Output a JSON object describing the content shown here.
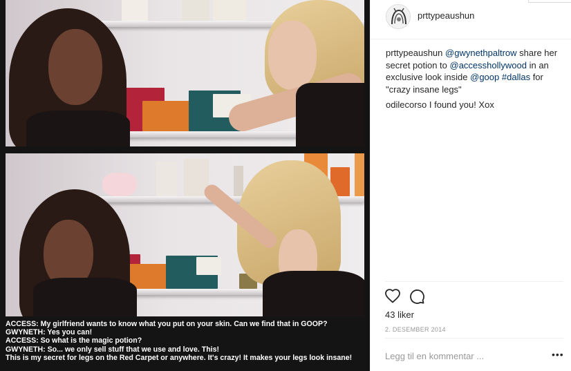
{
  "post": {
    "username": "prttypeaushun",
    "caption": {
      "user": "prttypeaushun",
      "t1": " ",
      "mention1": "@gwynethpaltrow",
      "t2": " share her secret potion to ",
      "mention2": "@accesshollywood",
      "t3": " in an exclusive look inside ",
      "mention3": "@goop",
      "t4": " ",
      "hashtag": "#dallas",
      "t5": " for \"crazy insane legs\""
    },
    "comment": {
      "user": "odilecorso",
      "text": " I found you! Xox"
    },
    "likes": "43 liker",
    "date": "2. DESEMBER 2014",
    "add_comment_placeholder": "Legg til en kommentar ...",
    "more_label": "•••"
  },
  "media": {
    "subtitles": [
      "ACCESS:  My girlfriend wants to know what you put on your skin. Can we find that in GOOP?",
      "GWYNETH: Yes you can!",
      "ACCESS: So what is the magic potion?",
      "GWYNETH: So... we only sell stuff that we use and love. This!",
      "This is my secret for legs on the Red Carpet or anywhere. It's crazy! It makes your legs look insane!"
    ]
  },
  "icons": {
    "like": "heart-icon",
    "comment": "comment-bubble-icon",
    "avatar": "avatar-image",
    "more": "more-options-icon"
  },
  "colors": {
    "link": "#003569",
    "muted": "#999999",
    "divider": "#efefef",
    "media_bg": "#141414"
  }
}
